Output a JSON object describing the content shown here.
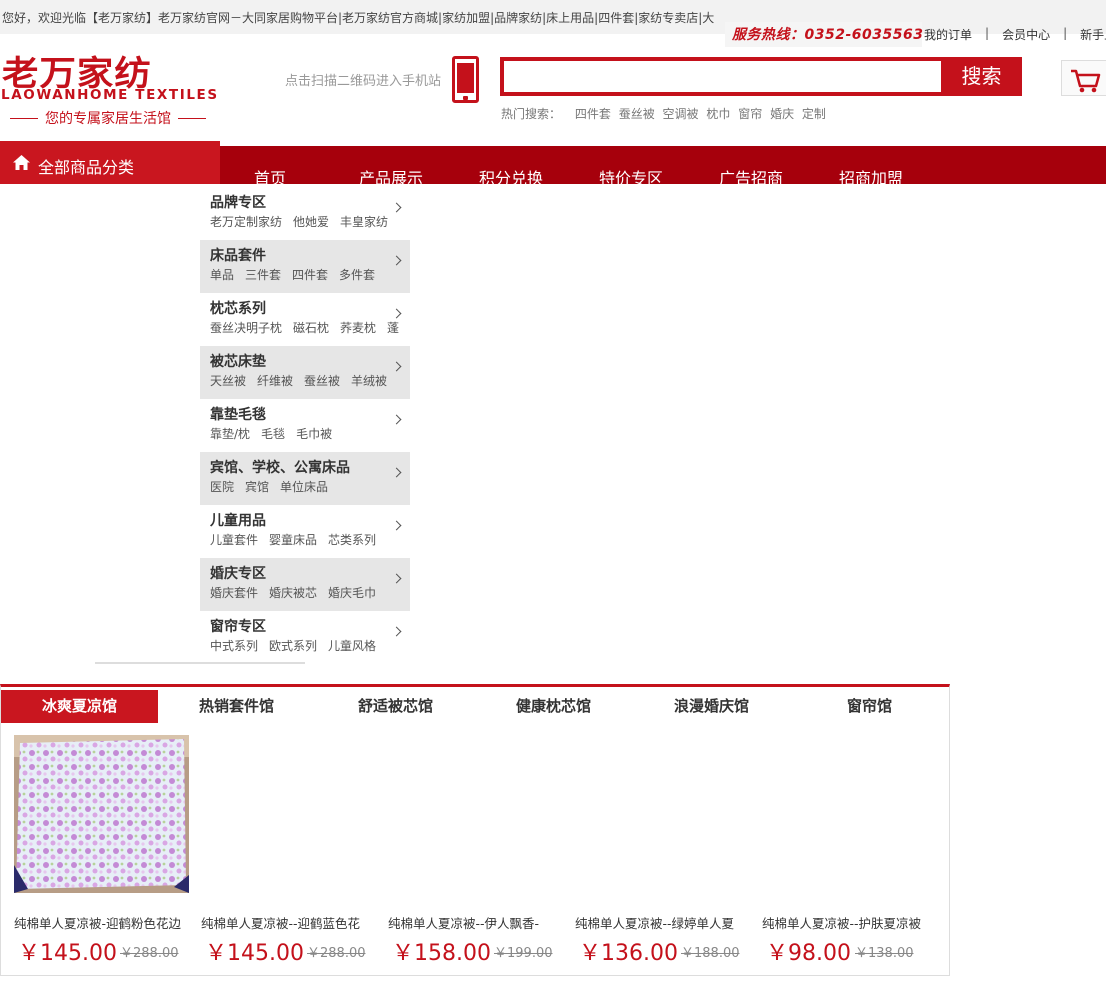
{
  "topbar": {
    "welcome": "您好，欢迎光临【老万家纺】老万家纺官网－大同家居购物平台|老万家纺官方商城|家纺加盟|品牌家纺|床上用品|四件套|家纺专卖店|大",
    "hotline": "服务热线：0352-6035563",
    "links": [
      "我的订单",
      "会员中心",
      "新手上路"
    ]
  },
  "logo": {
    "cn": "老万家纺",
    "en": "LAOWANHOME TEXTILES",
    "slogan": "您的专属家居生活馆"
  },
  "header": {
    "qr_text": "点击扫描二维码进入手机站",
    "search_placeholder": "",
    "search_button": "搜索",
    "hot_label": "热门搜索：",
    "hot_keywords": [
      "四件套",
      "蚕丝被",
      "空调被",
      "枕巾",
      "窗帘",
      "婚庆",
      "定制"
    ]
  },
  "nav": {
    "all_categories": "全部商品分类",
    "items": [
      "首页",
      "产品展示",
      "积分兑换",
      "特价专区",
      "广告招商",
      "招商加盟"
    ]
  },
  "categories": [
    {
      "title": "品牌专区",
      "subs": [
        "老万定制家纺",
        "他她爱",
        "丰皇家纺"
      ]
    },
    {
      "title": "床品套件",
      "subs": [
        "单品",
        "三件套",
        "四件套",
        "多件套"
      ]
    },
    {
      "title": "枕芯系列",
      "subs": [
        "蚕丝决明子枕",
        "磁石枕",
        "荞麦枕",
        "蓬"
      ]
    },
    {
      "title": "被芯床垫",
      "subs": [
        "天丝被",
        "纤维被",
        "蚕丝被",
        "羊绒被"
      ]
    },
    {
      "title": "靠垫毛毯",
      "subs": [
        "靠垫/枕",
        "毛毯",
        "毛巾被"
      ]
    },
    {
      "title": "宾馆、学校、公寓床品",
      "subs": [
        "医院",
        "宾馆",
        "单位床品"
      ]
    },
    {
      "title": "儿童用品",
      "subs": [
        "儿童套件",
        "婴童床品",
        "芯类系列"
      ]
    },
    {
      "title": "婚庆专区",
      "subs": [
        "婚庆套件",
        "婚庆被芯",
        "婚庆毛巾"
      ]
    },
    {
      "title": "窗帘专区",
      "subs": [
        "中式系列",
        "欧式系列",
        "儿童风格"
      ]
    }
  ],
  "floor": {
    "tabs": [
      "冰爽夏凉馆",
      "热销套件馆",
      "舒适被芯馆",
      "健康枕芯馆",
      "浪漫婚庆馆",
      "窗帘馆"
    ],
    "active_tab": 0,
    "products": [
      {
        "name": "纯棉单人夏凉被-迎鹤粉色花边",
        "price": "￥145.00",
        "old": "￥288.00"
      },
      {
        "name": "纯棉单人夏凉被--迎鹤蓝色花",
        "price": "￥145.00",
        "old": "￥288.00"
      },
      {
        "name": "纯棉单人夏凉被--伊人飘香-",
        "price": "￥158.00",
        "old": "￥199.00"
      },
      {
        "name": "纯棉单人夏凉被--绿婷单人夏",
        "price": "￥136.00",
        "old": "￥188.00"
      },
      {
        "name": "纯棉单人夏凉被--护肤夏凉被",
        "price": "￥98.00",
        "old": "￥138.00"
      }
    ]
  },
  "colors": {
    "brand_red": "#c4111b",
    "nav_dark_red": "#a6000c",
    "category_red": "#c9161f"
  },
  "icons": [
    "phone-icon",
    "home-icon",
    "cart-icon",
    "chevron-right-icon"
  ]
}
